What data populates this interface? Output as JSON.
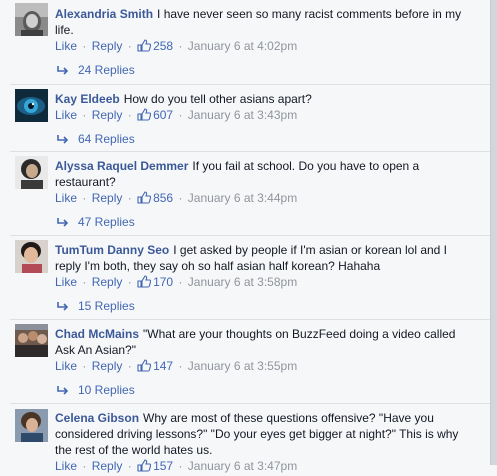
{
  "actions": {
    "like": "Like",
    "reply": "Reply",
    "separator": "·"
  },
  "comments": [
    {
      "author": "Alexandria Smith",
      "text": "I have never seen so many racist comments before in my life.",
      "likes": "258",
      "time": "January 6 at 4:02pm",
      "replies": "24 Replies",
      "avatar": "profile-photo-grayscale"
    },
    {
      "author": "Kay Eldeeb",
      "text": "How do you tell other asians apart?",
      "likes": "607",
      "time": "January 6 at 3:43pm",
      "replies": "64 Replies",
      "avatar": "profile-photo-blue-eye"
    },
    {
      "author": "Alyssa Raquel Demmer",
      "text": "If you fail at school. Do you have to open a restaurant?",
      "likes": "856",
      "time": "January 6 at 3:44pm",
      "replies": "47 Replies",
      "avatar": "profile-photo-portrait"
    },
    {
      "author": "TumTum Danny Seo",
      "text": "I get asked by people if I'm asian or korean lol and I reply I'm both, they say oh so half asian half korean? Hahaha",
      "likes": "170",
      "time": "January 6 at 3:58pm",
      "replies": "15 Replies",
      "avatar": "profile-photo-child"
    },
    {
      "author": "Chad McMains",
      "text": "\"What are your thoughts on BuzzFeed doing a video called Ask An Asian?\"",
      "likes": "147",
      "time": "January 6 at 3:55pm",
      "replies": "10 Replies",
      "avatar": "profile-photo-group"
    },
    {
      "author": "Celena Gibson",
      "text": "Why are most of these questions offensive? \"Have you considered driving lessons?\" \"Do your eyes get bigger at night?\" This is why the rest of the world hates us.",
      "likes": "157",
      "time": "January 6 at 3:47pm",
      "replies": "",
      "avatar": "profile-photo-woman"
    }
  ],
  "colors": {
    "link": "#4267b2",
    "author": "#3b5998",
    "meta": "#90949c",
    "background": "#f6f7f9"
  }
}
